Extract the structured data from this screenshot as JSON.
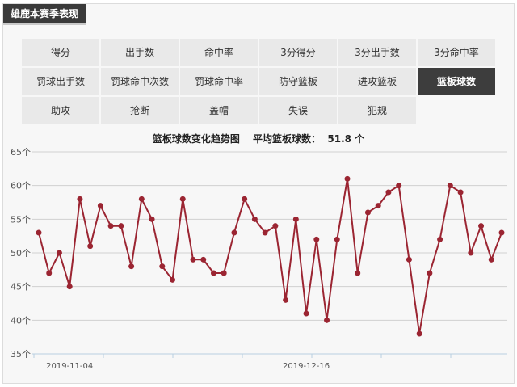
{
  "header": {
    "title": "雄鹿本赛季表现"
  },
  "tabs": [
    [
      "得分",
      "出手数",
      "命中率",
      "3分得分",
      "3分出手数",
      "3分命中率"
    ],
    [
      "罚球出手数",
      "罚球命中次数",
      "罚球命中率",
      "防守篮板",
      "进攻篮板",
      "篮板球数"
    ],
    [
      "助攻",
      "抢断",
      "盖帽",
      "失误",
      "犯规"
    ]
  ],
  "active_tab": "篮板球数",
  "chart_title": {
    "name": "篮板球数变化趋势图",
    "avg_label": "平均篮板球数：",
    "avg_value": "51.8 个"
  },
  "colors": {
    "line": "#9b2532",
    "grid": "#d0d0d0",
    "axis": "#b8cfe0",
    "active_tab": "#3d3d3d"
  },
  "chart_data": {
    "type": "line",
    "title": "篮板球数变化趋势图",
    "ylim": [
      35,
      65
    ],
    "yticks": [
      35,
      40,
      45,
      50,
      55,
      60,
      65
    ],
    "ytick_suffix": "个",
    "xtick_labels": [
      {
        "index": 3,
        "label": "2019-11-04"
      },
      {
        "index": 26,
        "label": "2019-12-16"
      }
    ],
    "grid": true,
    "series": [
      {
        "values": [
          53,
          47,
          50,
          45,
          58,
          51,
          57,
          54,
          54,
          48,
          58,
          55,
          48,
          46,
          58,
          49,
          49,
          47,
          47,
          53,
          58,
          55,
          53,
          54,
          43,
          55,
          41,
          52,
          40,
          52,
          61,
          47,
          56,
          57,
          59,
          60,
          49,
          38,
          47,
          52,
          60,
          59,
          50,
          54,
          49,
          53
        ]
      }
    ]
  }
}
